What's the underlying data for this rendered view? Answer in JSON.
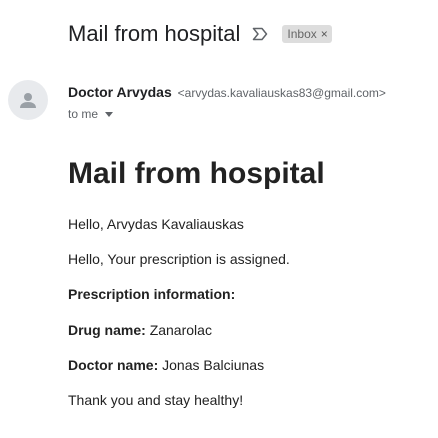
{
  "email": {
    "subject": "Mail from hospital",
    "importance_icon": "importance-marker-icon",
    "label": "Inbox",
    "label_close": "×",
    "avatar_icon": "person-icon",
    "sender": {
      "name": "Doctor Arvydas",
      "email": "<arvydas.kavaliauskas83@gmail.com>"
    },
    "recipient": "to me",
    "dropdown_icon": "chevron-down-icon"
  },
  "message": {
    "title": "Mail from hospital",
    "greeting": "Hello, Arvydas Kavaliauskas",
    "intro": "Hello, Your prescription is assigned.",
    "info_heading": "Prescription information:",
    "drug_label": "Drug name:",
    "drug_value": "Zanarolac",
    "doctor_label": "Doctor name:",
    "doctor_value": "Jonas Balciunas",
    "closing": "Thank you and stay healthy!"
  },
  "colors": {
    "label_chip_bg": "#dddddd",
    "avatar_bg": "#e8eaed",
    "secondary_text": "#5f6368"
  }
}
